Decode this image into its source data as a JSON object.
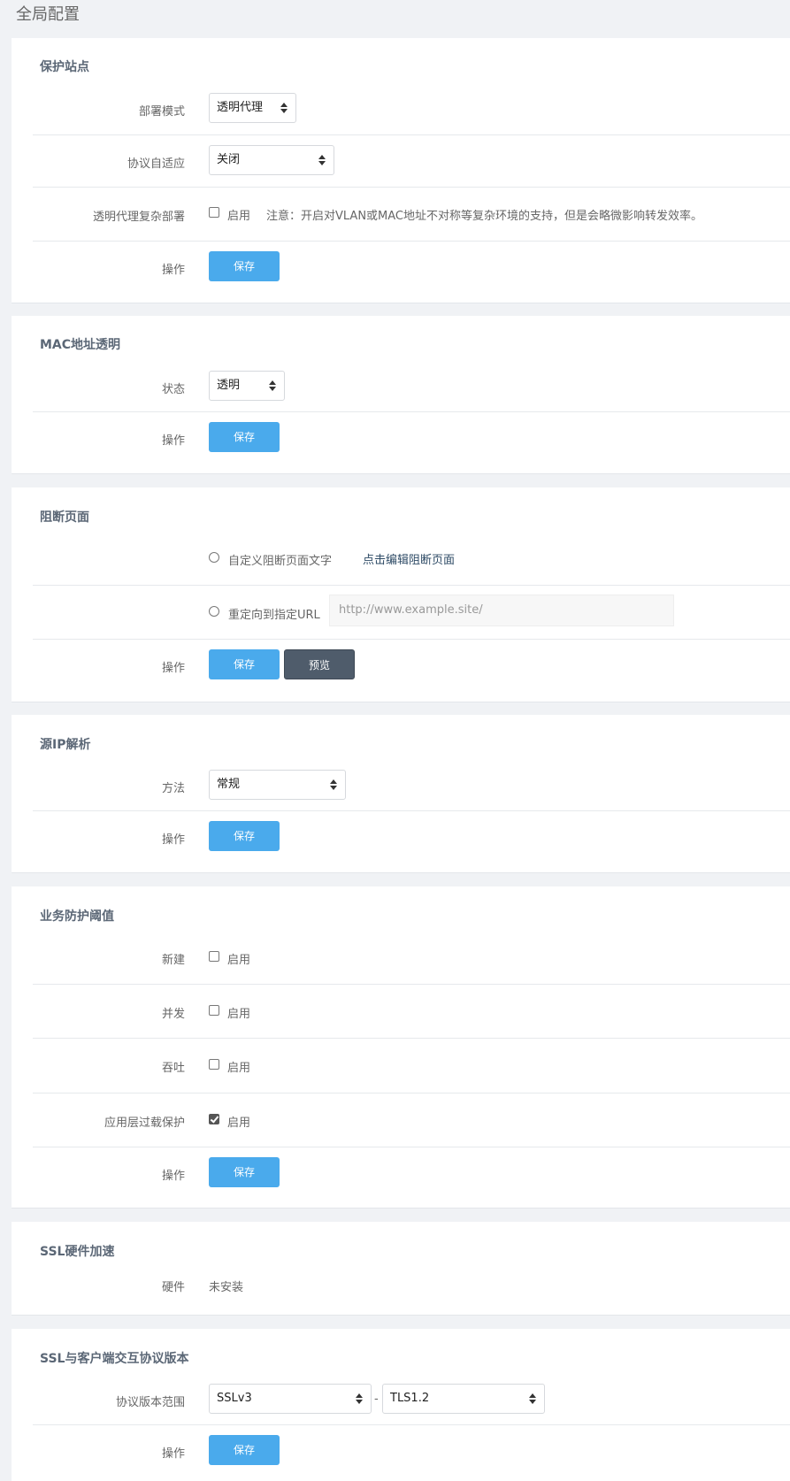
{
  "page_title": "全局配置",
  "protect_site": {
    "title": "保护站点",
    "deploy_mode": {
      "label": "部署模式",
      "value": "透明代理"
    },
    "protocol_adapt": {
      "label": "协议自适应",
      "value": "关闭"
    },
    "complex_deploy": {
      "label": "透明代理复杂部署",
      "checkbox_label": "启用",
      "checked": false,
      "note": "注意：开启对VLAN或MAC地址不对称等复杂环境的支持，但是会略微影响转发效率。"
    },
    "op_label": "操作",
    "save": "保存"
  },
  "mac_transparent": {
    "title": "MAC地址透明",
    "state": {
      "label": "状态",
      "value": "透明"
    },
    "op_label": "操作",
    "save": "保存"
  },
  "block_page": {
    "title": "阻断页面",
    "custom_text": {
      "label": "自定义阻断页面文字",
      "link": "点击编辑阻断页面"
    },
    "redirect": {
      "label": "重定向到指定URL",
      "placeholder": "http://www.example.site/"
    },
    "op_label": "操作",
    "save": "保存",
    "preview": "预览"
  },
  "source_ip": {
    "title": "源IP解析",
    "method": {
      "label": "方法",
      "value": "常规"
    },
    "op_label": "操作",
    "save": "保存"
  },
  "thresholds": {
    "title": "业务防护阈值",
    "items": [
      {
        "label": "新建",
        "checkbox_label": "启用",
        "checked": false
      },
      {
        "label": "并发",
        "checkbox_label": "启用",
        "checked": false
      },
      {
        "label": "吞吐",
        "checkbox_label": "启用",
        "checked": false
      },
      {
        "label": "应用层过载保护",
        "checkbox_label": "启用",
        "checked": true
      }
    ],
    "op_label": "操作",
    "save": "保存"
  },
  "ssl_hw": {
    "title": "SSL硬件加速",
    "hardware": {
      "label": "硬件",
      "value": "未安装"
    }
  },
  "ssl_version": {
    "title": "SSL与客户端交互协议版本",
    "range": {
      "label": "协议版本范围",
      "from": "SSLv3",
      "separator": "-",
      "to": "TLS1.2"
    },
    "op_label": "操作",
    "save": "保存"
  }
}
